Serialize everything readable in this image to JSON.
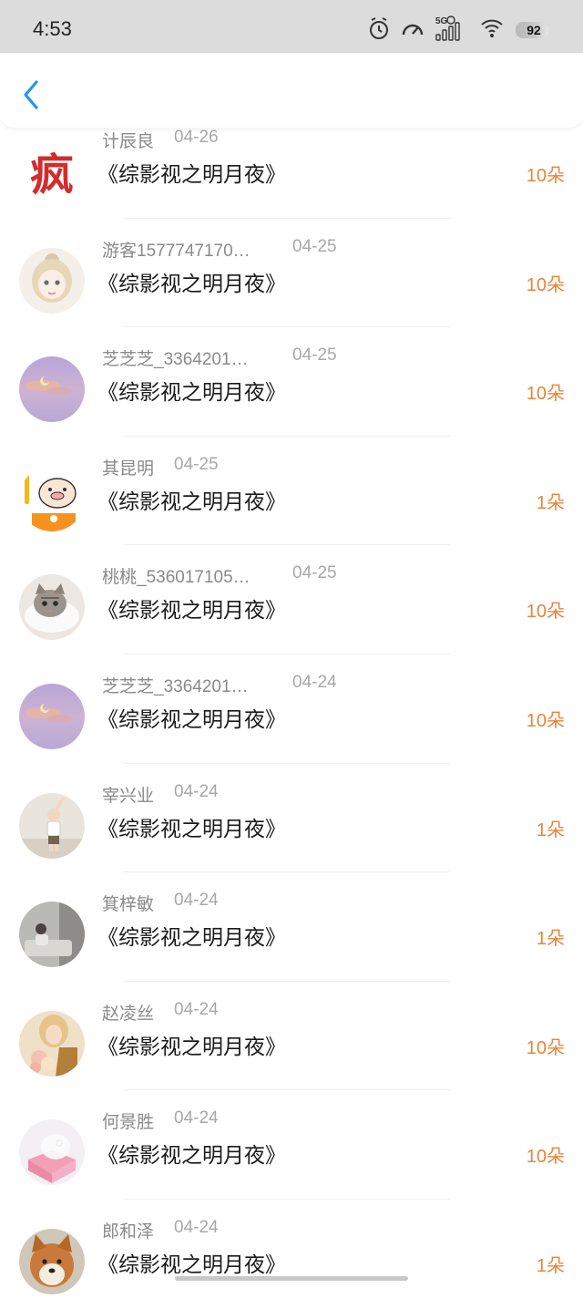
{
  "status_bar": {
    "time": "4:53",
    "network": "5G",
    "battery": "92",
    "icons": [
      "alarm-clock-icon",
      "speedometer-icon",
      "signal-5g-icon",
      "wifi-icon",
      "battery-icon"
    ]
  },
  "header": {
    "back_icon": "chevron-left-icon",
    "accent_color": "#2196f3"
  },
  "colors": {
    "count": "#e8843a",
    "name": "#8a8a8a",
    "date": "#a8a8a8",
    "title": "#1b1b1b"
  },
  "gifts": [
    {
      "user": "计辰良",
      "date": "04-26",
      "book": "《综影视之明月夜》",
      "count": "10朵",
      "avatar": "logo-char-avatar"
    },
    {
      "user": "游客1577747170…",
      "date": "04-25",
      "book": "《综影视之明月夜》",
      "count": "10朵",
      "avatar": "anime-girl-avatar"
    },
    {
      "user": "芝芝芝_3364201…",
      "date": "04-25",
      "book": "《综影视之明月夜》",
      "count": "10朵",
      "avatar": "purple-sky-moon-avatar"
    },
    {
      "user": "其昆明",
      "date": "04-25",
      "book": "《综影视之明月夜》",
      "count": "1朵",
      "avatar": "cartoon-pig-avatar"
    },
    {
      "user": "桃桃_536017105…",
      "date": "04-25",
      "book": "《综影视之明月夜》",
      "count": "10朵",
      "avatar": "kitten-avatar"
    },
    {
      "user": "芝芝芝_3364201…",
      "date": "04-24",
      "book": "《综影视之明月夜》",
      "count": "10朵",
      "avatar": "purple-sky-moon-avatar"
    },
    {
      "user": "宰兴业",
      "date": "04-24",
      "book": "《综影视之明月夜》",
      "count": "1朵",
      "avatar": "child-photo-avatar"
    },
    {
      "user": "箕梓敏",
      "date": "04-24",
      "book": "《综影视之明月夜》",
      "count": "1朵",
      "avatar": "room-photo-avatar"
    },
    {
      "user": "赵凌丝",
      "date": "04-24",
      "book": "《综影视之明月夜》",
      "count": "10朵",
      "avatar": "woman-flowers-avatar"
    },
    {
      "user": "何景胜",
      "date": "04-24",
      "book": "《综影视之明月夜》",
      "count": "10朵",
      "avatar": "pink-gift-avatar"
    },
    {
      "user": "郎和泽",
      "date": "04-24",
      "book": "《综影视之明月夜》",
      "count": "1朵",
      "avatar": "shiba-dog-avatar"
    }
  ]
}
